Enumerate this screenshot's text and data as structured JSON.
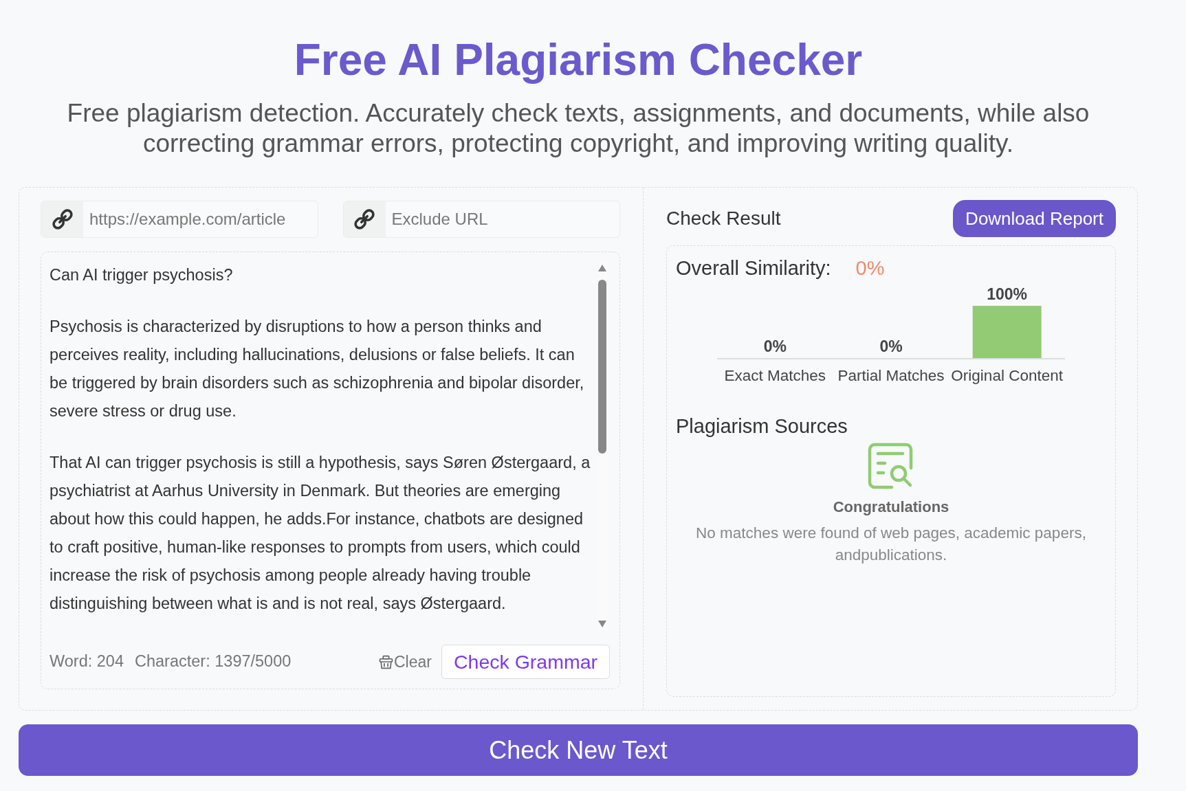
{
  "header": {
    "title": "Free AI Plagiarism Checker",
    "subtitle": "Free plagiarism detection. Accurately check texts, assignments, and documents, while also correcting grammar errors, protecting copyright, and improving writing quality."
  },
  "url_inputs": [
    {
      "placeholder": "https://example.com/article"
    },
    {
      "placeholder": "Exclude URL"
    }
  ],
  "editor": {
    "paragraphs": [
      "Can AI trigger psychosis?",
      "Psychosis is characterized by disruptions to how a person thinks and perceives reality, including hallucinations, delusions or false beliefs. It can be triggered by brain disorders such as schizophrenia and bipolar disorder, severe stress or drug use.",
      "That AI can trigger psychosis is still a hypothesis, says Søren Østergaard, a psychiatrist at Aarhus University in Denmark. But theories are emerging about how this could happen, he adds.For instance, chatbots are designed to craft positive, human-like responses to prompts from users, which could increase the risk of psychosis among people already having trouble distinguishing between what is and is not real, says Østergaard."
    ],
    "word_count": "Word: 204",
    "character_count": "Character: 1397/5000",
    "clear_button": "Clear",
    "check_grammar_button": "Check Grammar"
  },
  "result": {
    "title": "Check Result",
    "download_button": "Download Report",
    "similarity_label": "Overall Similarity:",
    "similarity_value": "0%",
    "chart_data": {
      "type": "bar",
      "categories": [
        "Exact Matches",
        "Partial Matches",
        "Original Content"
      ],
      "values": [
        0,
        0,
        100
      ],
      "ylim": [
        0,
        100
      ],
      "value_labels": [
        "0%",
        "0%",
        "100%"
      ]
    },
    "sources_title": "Plagiarism Sources",
    "empty_title": "Congratulations",
    "empty_message": "No matches were found of web pages, academic papers, andpublications."
  },
  "check_new_text_button": "Check New Text"
}
